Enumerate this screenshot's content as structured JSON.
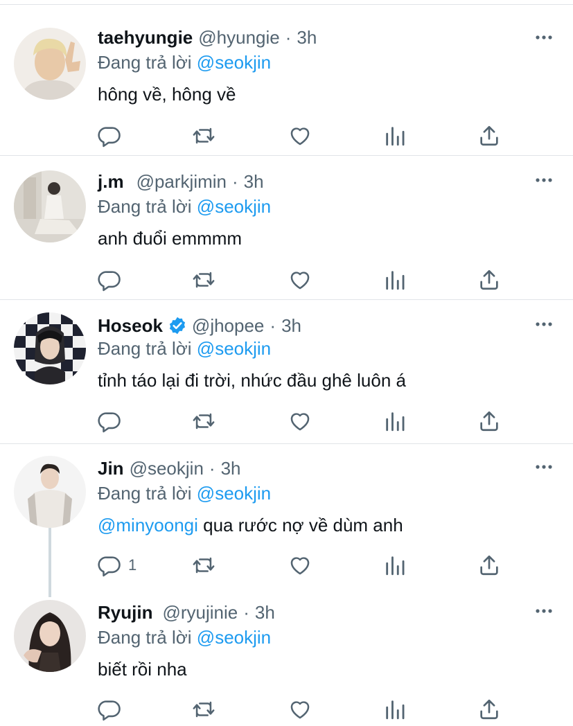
{
  "tweets": [
    {
      "name": "taehyungie",
      "handle": "@hyungie",
      "time": "3h",
      "reply_prefix": "Đang trả lời",
      "reply_to": "@seokjin",
      "text_mention": "",
      "text": "hông về, hông về",
      "reply_count": "",
      "verified": false
    },
    {
      "name": "j.m",
      "handle": "@parkjimin",
      "time": "3h",
      "reply_prefix": "Đang trả lời",
      "reply_to": "@seokjin",
      "text_mention": "",
      "text": "anh đuổi emmmm",
      "reply_count": "",
      "verified": false
    },
    {
      "name": "Hoseok",
      "handle": "@jhopee",
      "time": "3h",
      "reply_prefix": "Đang trả lời",
      "reply_to": "@seokjin",
      "text_mention": "",
      "text": "tỉnh táo lại đi trời, nhức đầu ghê luôn á",
      "reply_count": "",
      "verified": true
    },
    {
      "name": "Jin",
      "handle": "@seokjin",
      "time": "3h",
      "reply_prefix": "Đang trả lời",
      "reply_to": "@seokjin",
      "text_mention": "@minyoongi",
      "text": "qua rước nợ về dùm anh",
      "reply_count": "1",
      "verified": false
    },
    {
      "name": "Ryujin",
      "handle": "@ryujinie",
      "time": "3h",
      "reply_prefix": "Đang trả lời",
      "reply_to": "@seokjin",
      "text_mention": "",
      "text": "biết rồi nha",
      "reply_count": "",
      "verified": false
    }
  ],
  "separator": "·",
  "icons": {
    "reply": "reply-icon",
    "retweet": "retweet-icon",
    "like": "heart-icon",
    "views": "bar-chart-icon",
    "share": "share-icon",
    "more": "more-icon",
    "verified": "verified-badge-icon"
  },
  "colors": {
    "text": "#0f1419",
    "secondary": "#536471",
    "accent": "#1d9bf0",
    "divider": "#e1e4e8"
  }
}
